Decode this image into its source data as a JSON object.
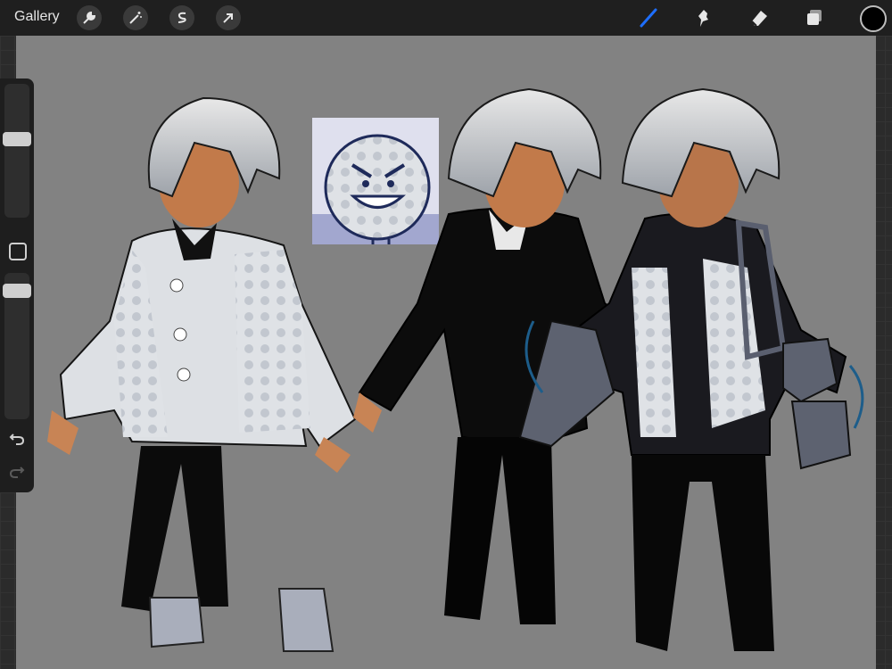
{
  "topbar": {
    "gallery_label": "Gallery",
    "left_tools": [
      {
        "name": "actions",
        "icon": "wrench-icon"
      },
      {
        "name": "adjustments",
        "icon": "magic-wand-icon"
      },
      {
        "name": "selection",
        "icon": "selection-s-icon"
      },
      {
        "name": "transform",
        "icon": "arrow-cursor-icon"
      }
    ],
    "right_tools": [
      {
        "name": "brush",
        "icon": "brush-icon",
        "active": true
      },
      {
        "name": "smudge",
        "icon": "smudge-icon"
      },
      {
        "name": "eraser",
        "icon": "eraser-icon"
      },
      {
        "name": "layers",
        "icon": "layers-icon"
      }
    ],
    "active_color": "#000000",
    "accent_color": "#1e6fff"
  },
  "sidebar": {
    "brush_size_level": 0.6,
    "opacity_level": 0.92,
    "icons": [
      "modify-square-icon",
      "undo-icon",
      "redo-icon"
    ]
  },
  "canvas": {
    "background_color": "#828282"
  }
}
